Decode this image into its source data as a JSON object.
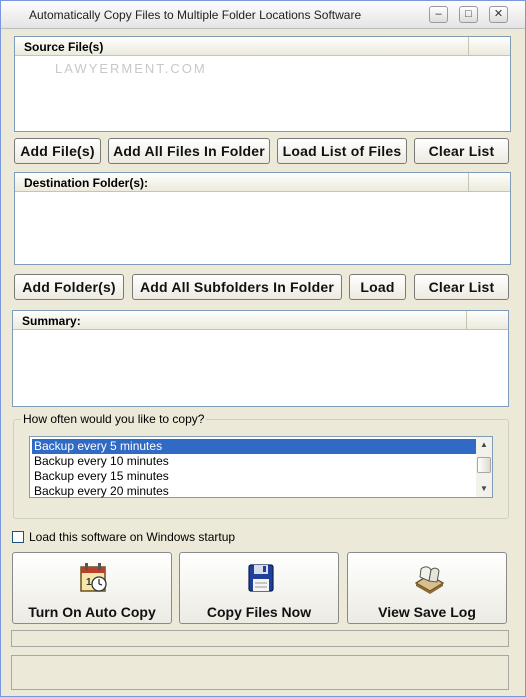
{
  "window": {
    "title": "Automatically Copy Files to Multiple Folder Locations Software",
    "controls": {
      "minimize": "–",
      "maximize": "□",
      "close": "✕"
    }
  },
  "source": {
    "header": "Source File(s)",
    "watermark": "LAWYERMENT.COM",
    "buttons": {
      "add_files": "Add File(s)",
      "add_all_files": "Add All Files In Folder",
      "load_list": "Load List of Files",
      "clear": "Clear List"
    }
  },
  "destination": {
    "header": "Destination Folder(s):",
    "buttons": {
      "add_folders": "Add Folder(s)",
      "add_subfolders": "Add All Subfolders In Folder",
      "load": "Load",
      "clear": "Clear List"
    }
  },
  "summary": {
    "header": "Summary:"
  },
  "frequency": {
    "label": "How often would you like to copy?",
    "options": [
      "Backup every 5 minutes",
      "Backup every 10 minutes",
      "Backup every 15 minutes",
      "Backup every 20 minutes"
    ],
    "selected_index": 0
  },
  "startup": {
    "label": "Load this software on Windows startup",
    "checked": false
  },
  "actions": {
    "auto_copy": "Turn On Auto Copy",
    "copy_now": "Copy Files Now",
    "view_log": "View Save Log"
  },
  "colors": {
    "selection": "#316ac5",
    "face": "#ece9d8",
    "border": "#7f9db9"
  }
}
